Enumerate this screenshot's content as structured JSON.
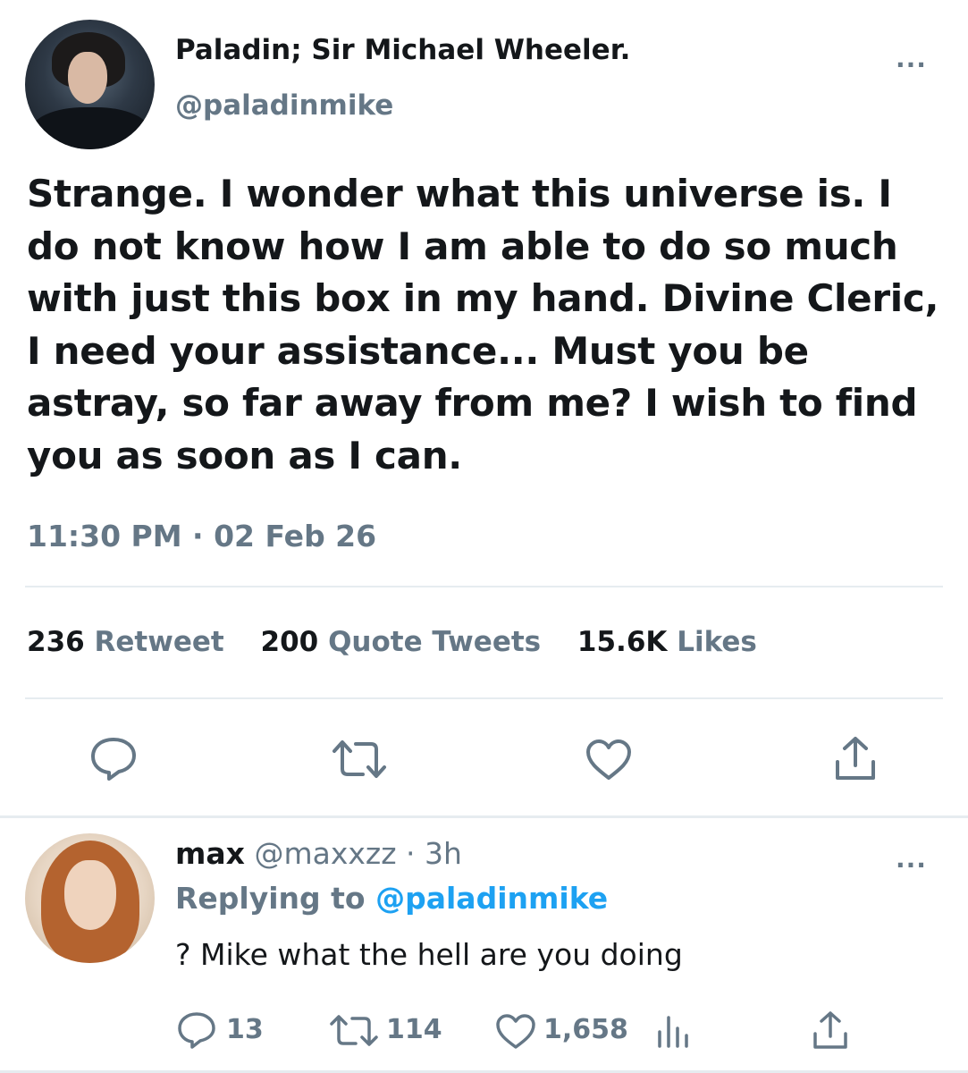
{
  "tweet": {
    "display_name": "Paladin; Sir Michael Wheeler.",
    "handle": "@paladinmike",
    "more_label": "...",
    "text": "Strange. I wonder what this universe is. I do not know how I am able to do so much with just this box in my hand. Divine Cleric, I need your assistance... Must you be astray, so far away from me? I wish to find you as soon as I can.",
    "timestamp": "11:30 PM · 02 Feb 26",
    "stats": {
      "retweets_count": "236",
      "retweets_label": "Retweet",
      "quotes_count": "200",
      "quotes_label": "Quote Tweets",
      "likes_count": "15.6K",
      "likes_label": "Likes"
    },
    "actions": [
      "reply-icon",
      "retweet-icon",
      "like-icon",
      "share-icon"
    ]
  },
  "reply": {
    "name": "max",
    "meta": "@maxxzz · 3h",
    "more_label": "...",
    "replying_prefix": "Replying to",
    "replying_handle": "@paladinmike",
    "text": "? Mike what the hell are you doing",
    "counts": {
      "replies": "13",
      "retweets": "114",
      "likes": "1,658"
    },
    "actions": [
      "reply-icon",
      "retweet-icon",
      "like-icon",
      "analytics-icon",
      "share-icon"
    ]
  },
  "colors": {
    "text": "#14171a",
    "secondary": "#657786",
    "link": "#1da1f2",
    "divider": "#e6ecf0"
  }
}
